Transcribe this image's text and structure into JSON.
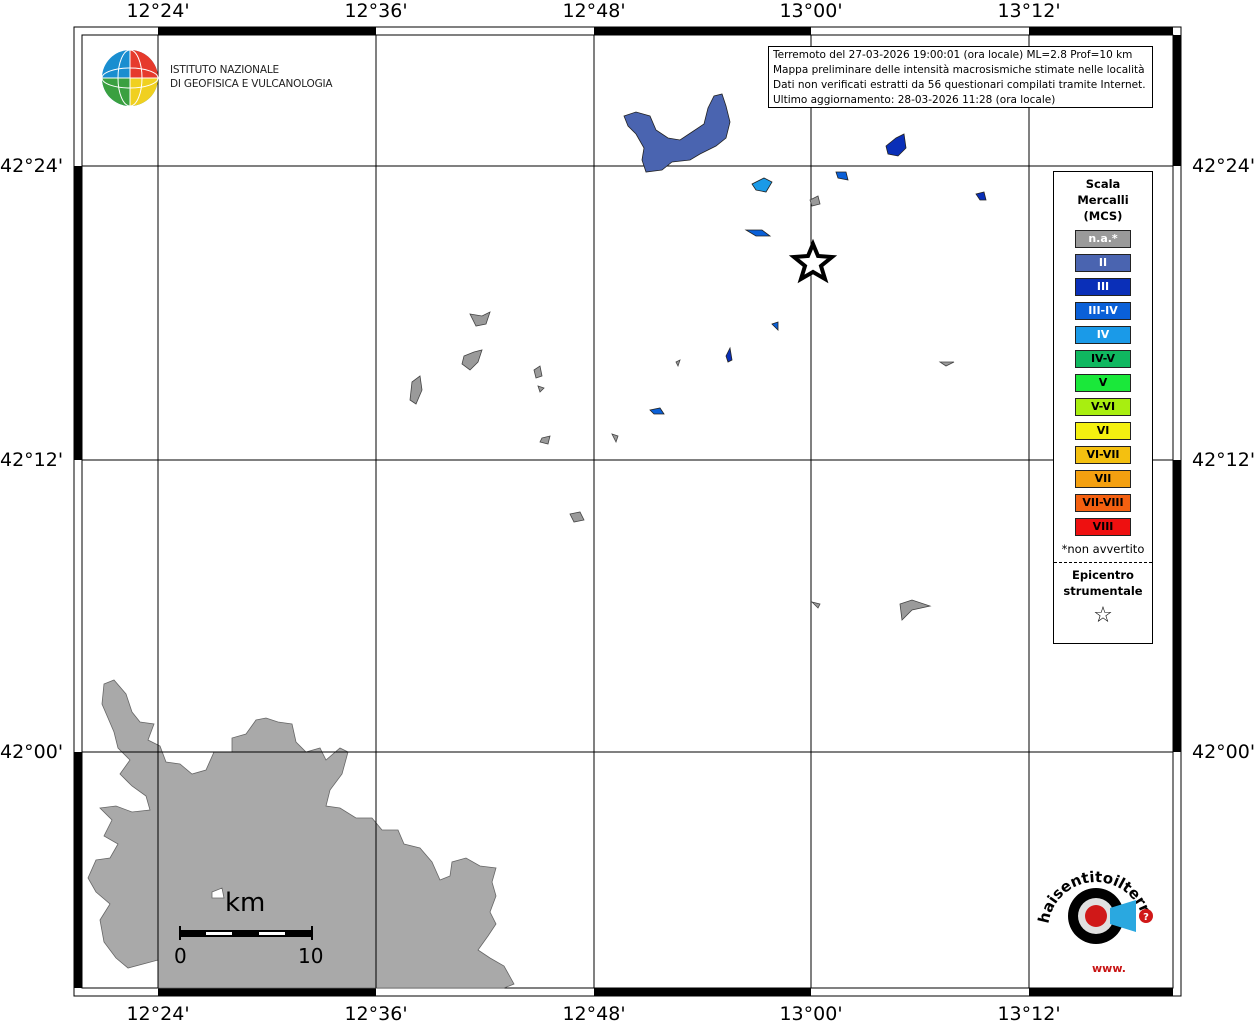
{
  "map": {
    "longitude_labels": [
      "12°24'",
      "12°36'",
      "12°48'",
      "13°00'",
      "13°12'"
    ],
    "latitude_labels": [
      "42°24'",
      "42°12'",
      "42°00'"
    ]
  },
  "info": {
    "line1": "Terremoto del 27-03-2026 19:00:01 (ora locale) ML=2.8 Prof=10 km",
    "line2": "Mappa preliminare delle intensità macrosismiche stimate nelle località",
    "line3": "Dati non verificati estratti da 56 questionari compilati tramite Internet.",
    "line4": "Ultimo aggiornamento: 28-03-2026 11:28 (ora locale)"
  },
  "logo": {
    "line1": "ISTITUTO NAZIONALE",
    "line2": "DI GEOFISICA E VULCANOLOGIA"
  },
  "legend": {
    "title_line1": "Scala",
    "title_line2": "Mercalli",
    "title_line3": "(MCS)",
    "items": [
      {
        "label": "n.a.*",
        "color": "#9a9a9a"
      },
      {
        "label": "II",
        "color": "#4a64b0"
      },
      {
        "label": "III",
        "color": "#0a2fb8"
      },
      {
        "label": "III-IV",
        "color": "#0a60d8"
      },
      {
        "label": "IV",
        "color": "#1a9ae8"
      },
      {
        "label": "IV-V",
        "color": "#10b860"
      },
      {
        "label": "V",
        "color": "#1ae83a"
      },
      {
        "label": "V-VI",
        "color": "#a8ee10"
      },
      {
        "label": "VI",
        "color": "#f4f010"
      },
      {
        "label": "VI-VII",
        "color": "#f4c010"
      },
      {
        "label": "VII",
        "color": "#f4a010"
      },
      {
        "label": "VII-VIII",
        "color": "#f46010"
      },
      {
        "label": "VIII",
        "color": "#ee1010"
      }
    ],
    "not_felt": "*non avvertito",
    "epicenter_line1": "Epicentro",
    "epicenter_line2": "strumentale"
  },
  "scale_bar": {
    "unit": "km",
    "min": "0",
    "max": "10"
  },
  "brand": {
    "text": "haisentitoilterremoto.it",
    "url": "www."
  }
}
